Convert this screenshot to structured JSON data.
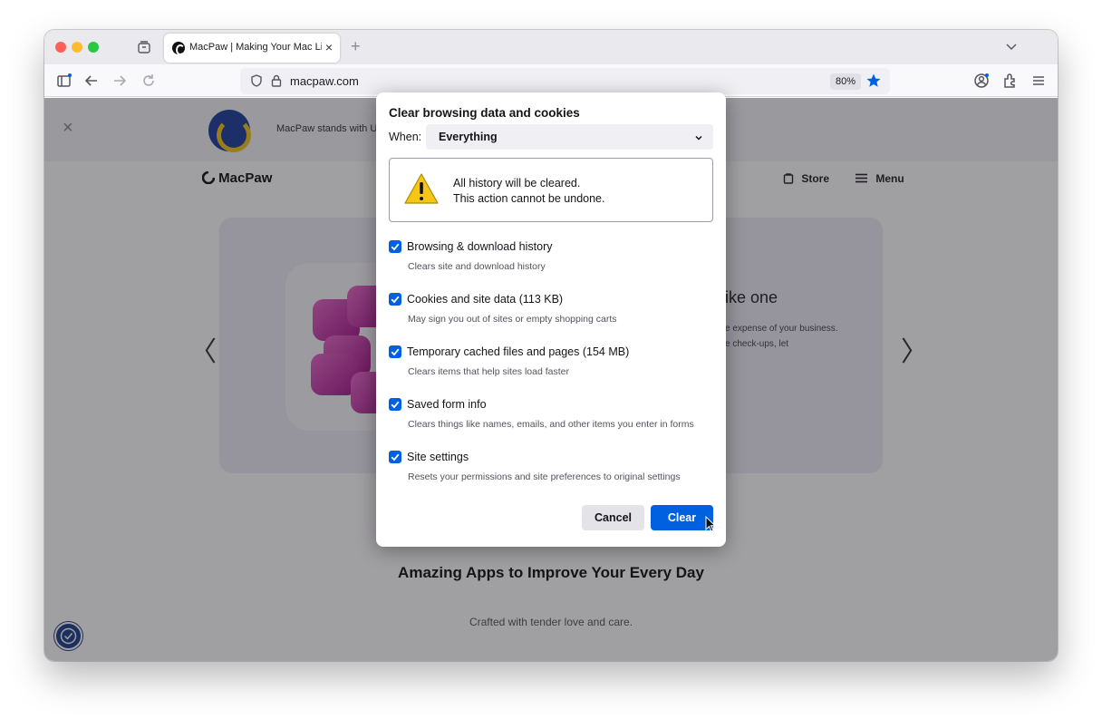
{
  "browser": {
    "tab": {
      "title": "MacPaw | Making Your Mac Life",
      "close_glyph": "×"
    },
    "new_tab_glyph": "+",
    "url": "macpaw.com",
    "zoom": "80%"
  },
  "page": {
    "banner": {
      "text": "MacPaw stands with U",
      "close_glyph": "×"
    },
    "nav": {
      "logo": "MacPaw",
      "store": "Store",
      "menu": "Menu"
    },
    "hero": {
      "heading": "ike one",
      "body_line1": "e expense of your business.",
      "body_line2": "e check-ups, let",
      "prev_glyph": "〈",
      "next_glyph": "〉"
    },
    "section": {
      "title": "Amazing Apps to Improve Your Every Day",
      "subtitle": "Crafted with tender love and care."
    }
  },
  "dialog": {
    "title": "Clear browsing data and cookies",
    "when_label": "When:",
    "when_value": "Everything",
    "warning_line1": "All history will be cleared.",
    "warning_line2": "This action cannot be undone.",
    "options": [
      {
        "label": "Browsing & download history",
        "desc": "Clears site and download history",
        "checked": true
      },
      {
        "label": "Cookies and site data (113 KB)",
        "desc": "May sign you out of sites or empty shopping carts",
        "checked": true
      },
      {
        "label": "Temporary cached files and pages (154 MB)",
        "desc": "Clears items that help sites load faster",
        "checked": true
      },
      {
        "label": "Saved form info",
        "desc": "Clears things like names, emails, and other items you enter in forms",
        "checked": true
      },
      {
        "label": "Site settings",
        "desc": "Resets your permissions and site preferences to original settings",
        "checked": true
      }
    ],
    "cancel_label": "Cancel",
    "clear_label": "Clear"
  },
  "colors": {
    "accent": "#0061e0",
    "overlay": "#1c1b22",
    "warning_yellow": "#f5c518"
  },
  "icons": {
    "toolbar": [
      "sidebar-icon",
      "back-icon",
      "forward-icon",
      "reload-icon",
      "shield-icon",
      "lock-icon",
      "bookmark-star-icon",
      "account-icon",
      "extensions-icon",
      "hamburger-menu-icon"
    ],
    "dialog": [
      "warning-triangle-icon",
      "chevron-down-icon",
      "checkbox-check-icon"
    ]
  }
}
